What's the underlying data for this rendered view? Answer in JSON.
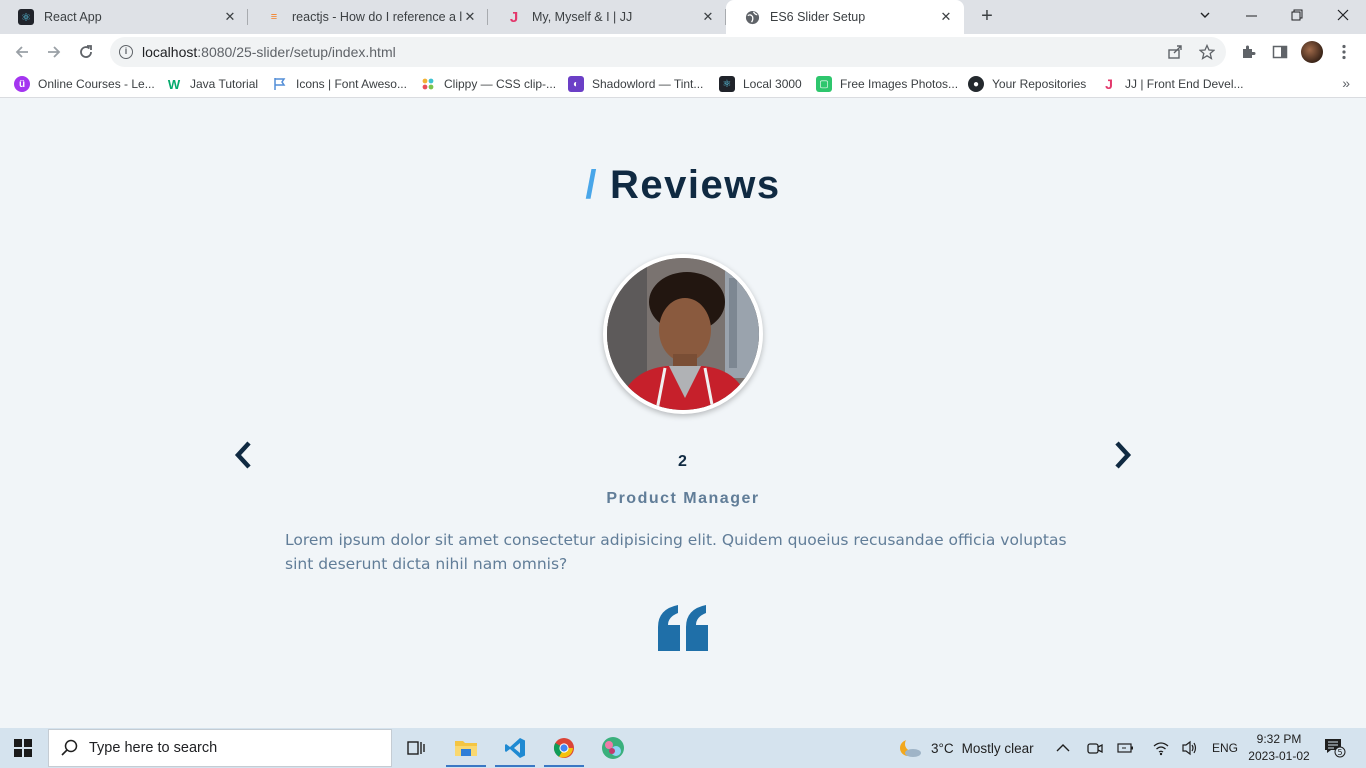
{
  "browser": {
    "tabs": [
      {
        "title": "React App",
        "favicon": "react-icon",
        "active": false
      },
      {
        "title": "reactjs - How do I reference a loc",
        "favicon": "stackoverflow-icon",
        "active": false
      },
      {
        "title": "My, Myself & I | JJ",
        "favicon": "jj-icon",
        "active": false
      },
      {
        "title": "ES6 Slider Setup",
        "favicon": "globe-icon",
        "active": true
      }
    ],
    "url_host": "localhost",
    "url_path": ":8080/25-slider/setup/index.html",
    "bookmarks": [
      {
        "label": "Online Courses - Le...",
        "icon": "udemy-icon",
        "color": "#a435f0"
      },
      {
        "label": "Java Tutorial",
        "icon": "w3schools-icon",
        "color": "#04aa6d"
      },
      {
        "label": "Icons | Font Aweso...",
        "icon": "flag-icon",
        "color": "#528dd7"
      },
      {
        "label": "Clippy — CSS clip-...",
        "icon": "clippy-icon",
        "color": "#f2b134"
      },
      {
        "label": "Shadowlord — Tint...",
        "icon": "shadowlord-icon",
        "color": "#6b3fc6"
      },
      {
        "label": "Local 3000",
        "icon": "react-icon",
        "color": "#20232a"
      },
      {
        "label": "Free Images Photos...",
        "icon": "pixabay-icon",
        "color": "#2ec66d"
      },
      {
        "label": "Your Repositories",
        "icon": "github-icon",
        "color": "#24292e"
      },
      {
        "label": "JJ | Front End Devel...",
        "icon": "jj-icon",
        "color": "#e3376b"
      }
    ]
  },
  "page": {
    "heading_slash": "/",
    "heading": "Reviews",
    "person_number": "2",
    "person_title": "Product Manager",
    "person_text": "Lorem ipsum dolor sit amet consectetur adipisicing elit. Quidem quoeius recusandae officia voluptas sint deserunt dicta nihil nam omnis?",
    "colors": {
      "accent": "#49a6e9",
      "heading": "#102a42",
      "muted": "#617d98",
      "quote": "#1f6fa8"
    }
  },
  "taskbar": {
    "search_placeholder": "Type here to search",
    "weather_temp": "3°C",
    "weather_text": "Mostly clear",
    "language": "ENG",
    "time": "9:32 PM",
    "date": "2023-01-02",
    "notification_count": "5"
  }
}
